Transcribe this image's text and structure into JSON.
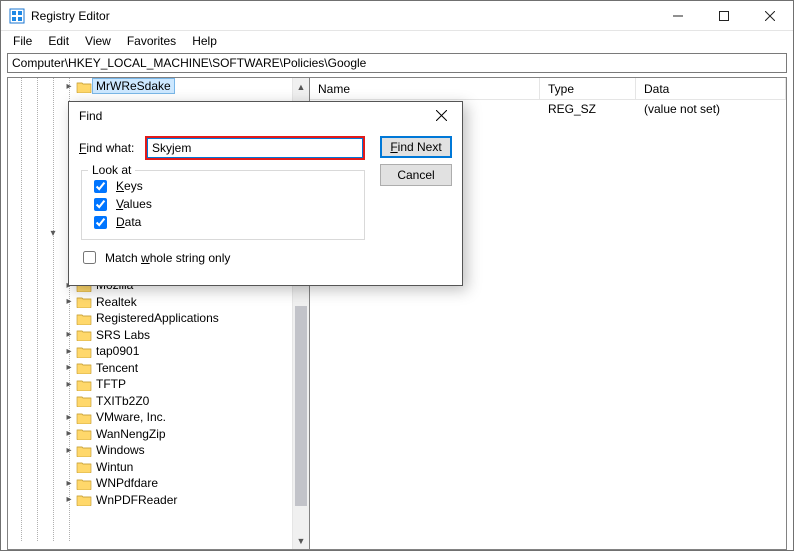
{
  "window": {
    "title": "Registry Editor"
  },
  "menu": {
    "file": "File",
    "edit": "Edit",
    "view": "View",
    "favorites": "Favorites",
    "help": "Help"
  },
  "address": "Computer\\HKEY_LOCAL_MACHINE\\SOFTWARE\\Policies\\Google",
  "columns": {
    "name": "Name",
    "type": "Type",
    "data": "Data"
  },
  "rows": [
    {
      "name": "",
      "type": "REG_SZ",
      "data": "(value not set)"
    }
  ],
  "tree": {
    "items": [
      {
        "indent": 4,
        "expander": ">",
        "label": "MrWReSdake",
        "selected": true
      },
      {
        "indent": 4,
        "expander": ">",
        "label": "Mozilla"
      },
      {
        "indent": 4,
        "expander": ">",
        "label": "Realtek"
      },
      {
        "indent": 4,
        "expander": "",
        "label": "RegisteredApplications"
      },
      {
        "indent": 4,
        "expander": ">",
        "label": "SRS Labs"
      },
      {
        "indent": 4,
        "expander": ">",
        "label": "tap0901"
      },
      {
        "indent": 4,
        "expander": ">",
        "label": "Tencent"
      },
      {
        "indent": 4,
        "expander": ">",
        "label": "TFTP"
      },
      {
        "indent": 4,
        "expander": "",
        "label": "TXITb2Z0"
      },
      {
        "indent": 4,
        "expander": ">",
        "label": "VMware, Inc."
      },
      {
        "indent": 4,
        "expander": ">",
        "label": "WanNengZip"
      },
      {
        "indent": 4,
        "expander": ">",
        "label": "Windows"
      },
      {
        "indent": 4,
        "expander": "",
        "label": "Wintun"
      },
      {
        "indent": 4,
        "expander": ">",
        "label": "WNPdfdare"
      },
      {
        "indent": 4,
        "expander": ">",
        "label": "WnPDFReader"
      }
    ]
  },
  "find": {
    "title": "Find",
    "find_what_label": "Find what:",
    "find_what_value": "Skyjem",
    "lookat_label": "Look at",
    "keys": "Keys",
    "values": "Values",
    "data": "Data",
    "match_whole": "Match whole string only",
    "find_next": "Find Next",
    "cancel": "Cancel",
    "keys_checked": true,
    "values_checked": true,
    "data_checked": true,
    "whole_checked": false
  }
}
